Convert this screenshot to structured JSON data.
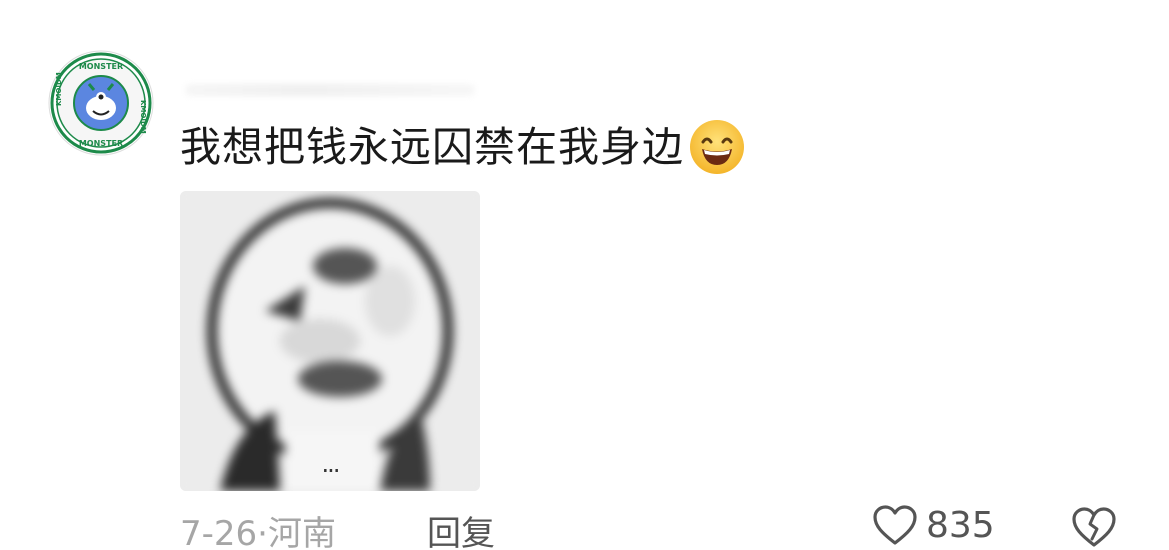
{
  "comment": {
    "avatar_icon": "monster-logo-avatar",
    "text": "我想把钱永远囚禁在我身边",
    "emoji_icon": "grinning-face-emoji",
    "sticker_icon": "blurry-face-meme-sticker",
    "sticker_more": "...",
    "date": "7-26",
    "separator": "·",
    "location": "河南",
    "reply_label": "回复",
    "like_icon": "heart-outline-icon",
    "like_count": "835",
    "dislike_icon": "broken-heart-icon"
  },
  "colors": {
    "text": "#1a1a1a",
    "meta": "#a6a6a6",
    "action": "#555555",
    "avatar_accent": "#1d8a4a",
    "avatar_bg": "#5b86e0"
  }
}
